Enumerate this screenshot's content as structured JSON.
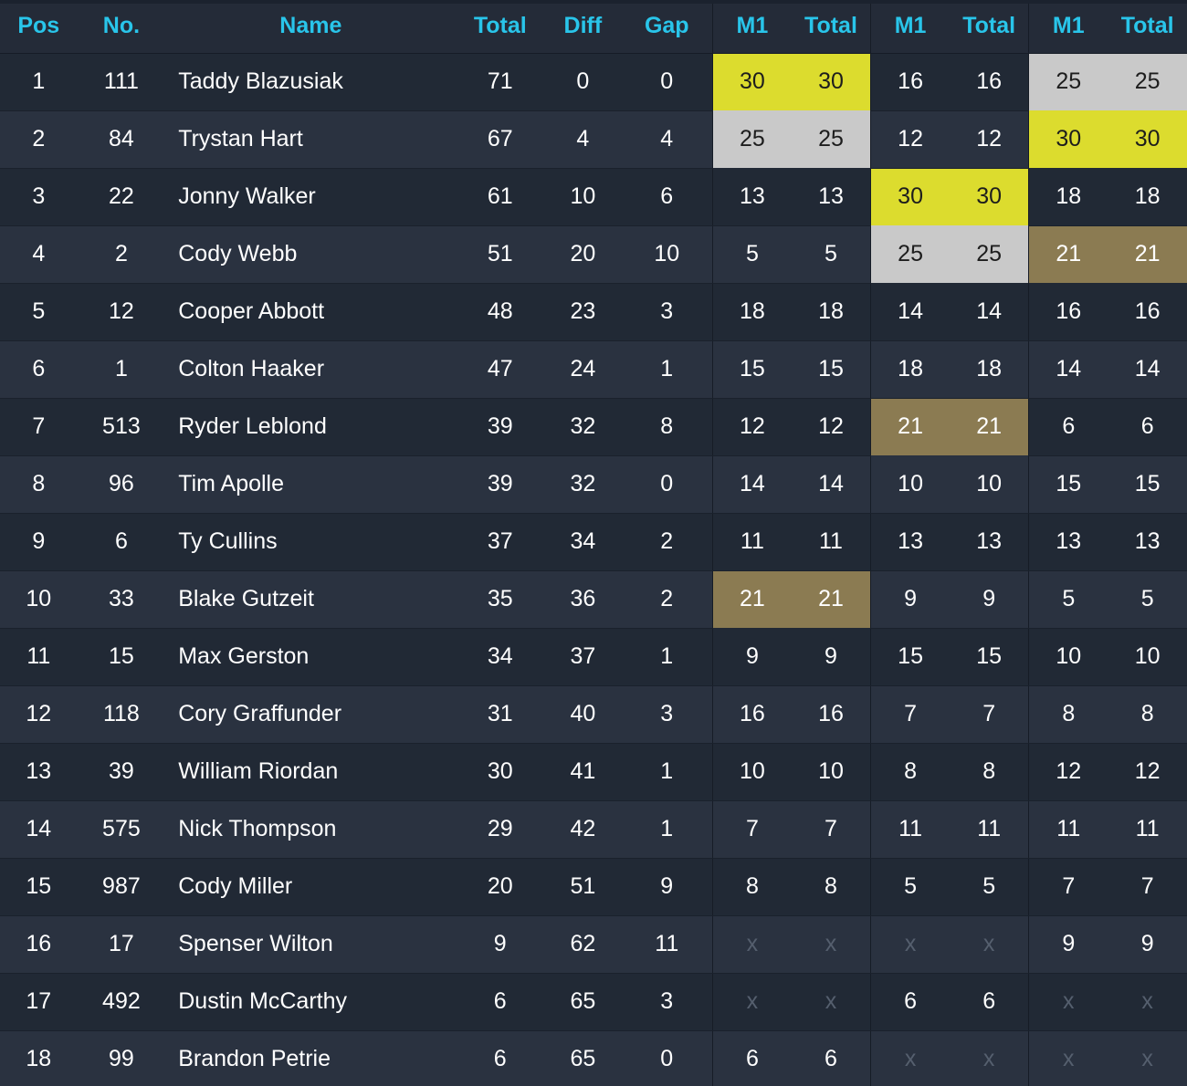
{
  "table": {
    "columns": [
      {
        "key": "pos",
        "label": "Pos",
        "group": null
      },
      {
        "key": "no",
        "label": "No.",
        "group": null
      },
      {
        "key": "name",
        "label": "Name",
        "group": null
      },
      {
        "key": "total",
        "label": "Total",
        "group": null
      },
      {
        "key": "diff",
        "label": "Diff",
        "group": null
      },
      {
        "key": "gap",
        "label": "Gap",
        "group": null
      },
      {
        "key": "m1_a",
        "label": "M1",
        "group": "moto1"
      },
      {
        "key": "tot_a",
        "label": "Total",
        "group": "moto1"
      },
      {
        "key": "m1_b",
        "label": "M1",
        "group": "moto2"
      },
      {
        "key": "tot_b",
        "label": "Total",
        "group": "moto2"
      },
      {
        "key": "m1_c",
        "label": "M1",
        "group": "moto3"
      },
      {
        "key": "tot_c",
        "label": "Total",
        "group": "moto3"
      }
    ],
    "colors": {
      "header_text": "#29c5ea",
      "gold": "#dcdc2e",
      "silver": "#c9c9c9",
      "bronze": "#8b7b52",
      "row_odd": "#212935",
      "row_even": "#2a3240",
      "header_bg": "#242b38",
      "body_text": "#ffffff",
      "dnf_text": "#555f6e"
    },
    "placeholder": "x",
    "rows": [
      {
        "pos": "1",
        "no": "111",
        "name": "Taddy Blazusiak",
        "total": "71",
        "diff": "0",
        "gap": "0",
        "m1_a": "30",
        "tot_a": "30",
        "hl_a": "gold",
        "m1_b": "16",
        "tot_b": "16",
        "hl_b": "none",
        "m1_c": "25",
        "tot_c": "25",
        "hl_c": "silver"
      },
      {
        "pos": "2",
        "no": "84",
        "name": "Trystan Hart",
        "total": "67",
        "diff": "4",
        "gap": "4",
        "m1_a": "25",
        "tot_a": "25",
        "hl_a": "silver",
        "m1_b": "12",
        "tot_b": "12",
        "hl_b": "none",
        "m1_c": "30",
        "tot_c": "30",
        "hl_c": "gold"
      },
      {
        "pos": "3",
        "no": "22",
        "name": "Jonny Walker",
        "total": "61",
        "diff": "10",
        "gap": "6",
        "m1_a": "13",
        "tot_a": "13",
        "hl_a": "none",
        "m1_b": "30",
        "tot_b": "30",
        "hl_b": "gold",
        "m1_c": "18",
        "tot_c": "18",
        "hl_c": "none"
      },
      {
        "pos": "4",
        "no": "2",
        "name": "Cody Webb",
        "total": "51",
        "diff": "20",
        "gap": "10",
        "m1_a": "5",
        "tot_a": "5",
        "hl_a": "none",
        "m1_b": "25",
        "tot_b": "25",
        "hl_b": "silver",
        "m1_c": "21",
        "tot_c": "21",
        "hl_c": "bronze"
      },
      {
        "pos": "5",
        "no": "12",
        "name": "Cooper Abbott",
        "total": "48",
        "diff": "23",
        "gap": "3",
        "m1_a": "18",
        "tot_a": "18",
        "hl_a": "none",
        "m1_b": "14",
        "tot_b": "14",
        "hl_b": "none",
        "m1_c": "16",
        "tot_c": "16",
        "hl_c": "none"
      },
      {
        "pos": "6",
        "no": "1",
        "name": "Colton Haaker",
        "total": "47",
        "diff": "24",
        "gap": "1",
        "m1_a": "15",
        "tot_a": "15",
        "hl_a": "none",
        "m1_b": "18",
        "tot_b": "18",
        "hl_b": "none",
        "m1_c": "14",
        "tot_c": "14",
        "hl_c": "none"
      },
      {
        "pos": "7",
        "no": "513",
        "name": "Ryder Leblond",
        "total": "39",
        "diff": "32",
        "gap": "8",
        "m1_a": "12",
        "tot_a": "12",
        "hl_a": "none",
        "m1_b": "21",
        "tot_b": "21",
        "hl_b": "bronze",
        "m1_c": "6",
        "tot_c": "6",
        "hl_c": "none"
      },
      {
        "pos": "8",
        "no": "96",
        "name": "Tim Apolle",
        "total": "39",
        "diff": "32",
        "gap": "0",
        "m1_a": "14",
        "tot_a": "14",
        "hl_a": "none",
        "m1_b": "10",
        "tot_b": "10",
        "hl_b": "none",
        "m1_c": "15",
        "tot_c": "15",
        "hl_c": "none"
      },
      {
        "pos": "9",
        "no": "6",
        "name": "Ty Cullins",
        "total": "37",
        "diff": "34",
        "gap": "2",
        "m1_a": "11",
        "tot_a": "11",
        "hl_a": "none",
        "m1_b": "13",
        "tot_b": "13",
        "hl_b": "none",
        "m1_c": "13",
        "tot_c": "13",
        "hl_c": "none"
      },
      {
        "pos": "10",
        "no": "33",
        "name": "Blake Gutzeit",
        "total": "35",
        "diff": "36",
        "gap": "2",
        "m1_a": "21",
        "tot_a": "21",
        "hl_a": "bronze",
        "m1_b": "9",
        "tot_b": "9",
        "hl_b": "none",
        "m1_c": "5",
        "tot_c": "5",
        "hl_c": "none"
      },
      {
        "pos": "11",
        "no": "15",
        "name": "Max Gerston",
        "total": "34",
        "diff": "37",
        "gap": "1",
        "m1_a": "9",
        "tot_a": "9",
        "hl_a": "none",
        "m1_b": "15",
        "tot_b": "15",
        "hl_b": "none",
        "m1_c": "10",
        "tot_c": "10",
        "hl_c": "none"
      },
      {
        "pos": "12",
        "no": "118",
        "name": "Cory Graffunder",
        "total": "31",
        "diff": "40",
        "gap": "3",
        "m1_a": "16",
        "tot_a": "16",
        "hl_a": "none",
        "m1_b": "7",
        "tot_b": "7",
        "hl_b": "none",
        "m1_c": "8",
        "tot_c": "8",
        "hl_c": "none"
      },
      {
        "pos": "13",
        "no": "39",
        "name": "William Riordan",
        "total": "30",
        "diff": "41",
        "gap": "1",
        "m1_a": "10",
        "tot_a": "10",
        "hl_a": "none",
        "m1_b": "8",
        "tot_b": "8",
        "hl_b": "none",
        "m1_c": "12",
        "tot_c": "12",
        "hl_c": "none"
      },
      {
        "pos": "14",
        "no": "575",
        "name": "Nick Thompson",
        "total": "29",
        "diff": "42",
        "gap": "1",
        "m1_a": "7",
        "tot_a": "7",
        "hl_a": "none",
        "m1_b": "11",
        "tot_b": "11",
        "hl_b": "none",
        "m1_c": "11",
        "tot_c": "11",
        "hl_c": "none"
      },
      {
        "pos": "15",
        "no": "987",
        "name": "Cody Miller",
        "total": "20",
        "diff": "51",
        "gap": "9",
        "m1_a": "8",
        "tot_a": "8",
        "hl_a": "none",
        "m1_b": "5",
        "tot_b": "5",
        "hl_b": "none",
        "m1_c": "7",
        "tot_c": "7",
        "hl_c": "none"
      },
      {
        "pos": "16",
        "no": "17",
        "name": "Spenser Wilton",
        "total": "9",
        "diff": "62",
        "gap": "11",
        "m1_a": "x",
        "tot_a": "x",
        "hl_a": "none",
        "m1_b": "x",
        "tot_b": "x",
        "hl_b": "none",
        "m1_c": "9",
        "tot_c": "9",
        "hl_c": "none"
      },
      {
        "pos": "17",
        "no": "492",
        "name": "Dustin McCarthy",
        "total": "6",
        "diff": "65",
        "gap": "3",
        "m1_a": "x",
        "tot_a": "x",
        "hl_a": "none",
        "m1_b": "6",
        "tot_b": "6",
        "hl_b": "none",
        "m1_c": "x",
        "tot_c": "x",
        "hl_c": "none"
      },
      {
        "pos": "18",
        "no": "99",
        "name": "Brandon Petrie",
        "total": "6",
        "diff": "65",
        "gap": "0",
        "m1_a": "6",
        "tot_a": "6",
        "hl_a": "none",
        "m1_b": "x",
        "tot_b": "x",
        "hl_b": "none",
        "m1_c": "x",
        "tot_c": "x",
        "hl_c": "none"
      }
    ]
  }
}
